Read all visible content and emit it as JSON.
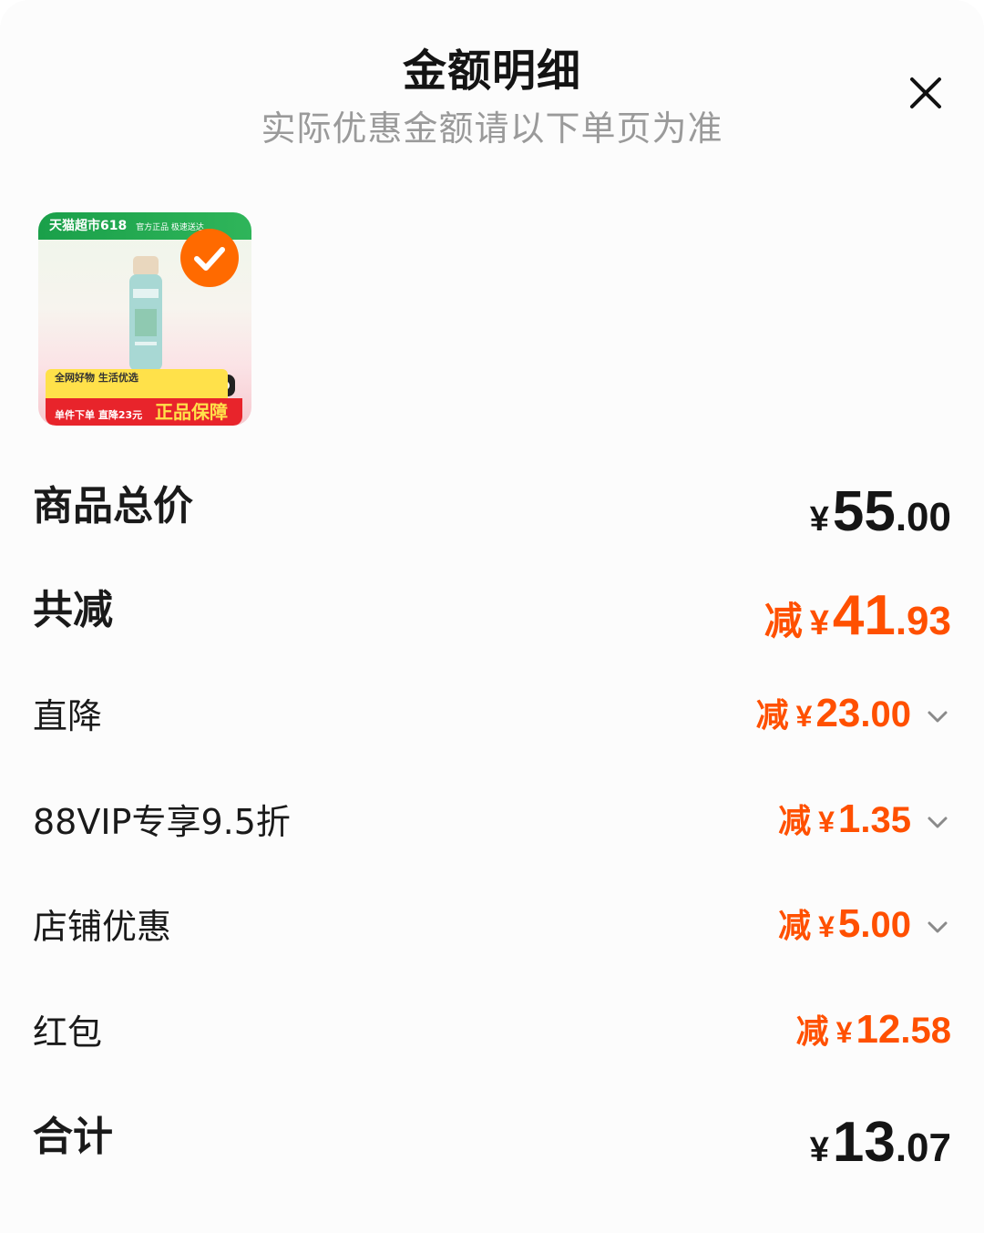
{
  "header": {
    "title": "金额明细",
    "subtitle": "实际优惠金额请以下单页为准"
  },
  "product": {
    "badge_brand": "天猫超市618",
    "badge_sub": "官方正品 极速送达",
    "line1": "全网好物 生活优选",
    "line2": "单件下单 直降23元",
    "guarantee": "正品保障",
    "selected": true
  },
  "rows": [
    {
      "label": "商品总价",
      "prefix": "",
      "yen": "¥",
      "int": "55",
      "dec": ".00"
    },
    {
      "label": "共减",
      "prefix": "减",
      "yen": "¥",
      "int": "41",
      "dec": ".93"
    },
    {
      "label": "直降",
      "prefix": "减",
      "yen": "¥",
      "int": "23",
      "dec": ".00"
    },
    {
      "label": "88VIP专享9.5折",
      "prefix": "减",
      "yen": "¥",
      "int": "1",
      "dec": ".35"
    },
    {
      "label": "店铺优惠",
      "prefix": "减",
      "yen": "¥",
      "int": "5",
      "dec": ".00"
    },
    {
      "label": "红包",
      "prefix": "减",
      "yen": "¥",
      "int": "12",
      "dec": ".58"
    },
    {
      "label": "合计",
      "prefix": "",
      "yen": "¥",
      "int": "13",
      "dec": ".07"
    }
  ],
  "colors": {
    "accent": "#ff5000",
    "text": "#1a1a1a",
    "muted": "#9a9a9a"
  }
}
